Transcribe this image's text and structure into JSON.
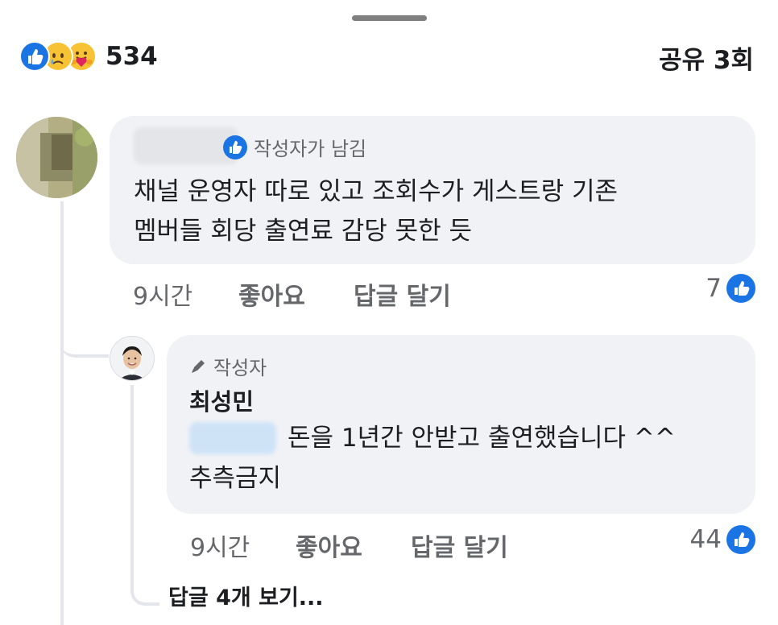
{
  "summary": {
    "reaction_count": "534",
    "share_label": "공유 3회",
    "reaction_icons": [
      "like-icon",
      "sad-face-icon",
      "care-face-icon"
    ]
  },
  "comments": [
    {
      "author_badge": "작성자가 남김",
      "text_lines": [
        "채널 운영자 따로 있고 조회수가 게스트랑 기존",
        "멤버들 회당 출연료 감당 못한 듯"
      ],
      "time": "9시간",
      "like_action": "좋아요",
      "reply_action": "답글 달기",
      "like_count": "7"
    },
    {
      "author_badge": "작성자",
      "author_name": "최성민",
      "text_lines": [
        "돈을 1년간 안받고 출연했습니다 ^^",
        "추측금지"
      ],
      "time": "9시간",
      "like_action": "좋아요",
      "reply_action": "답글 달기",
      "like_count": "44"
    }
  ],
  "view_more_replies": "답글 4개 보기...",
  "colors": {
    "accent": "#1b74e4",
    "bubble": "#f0f2f5",
    "meta_text": "#65676b",
    "thread_line": "#e4e6eb"
  }
}
